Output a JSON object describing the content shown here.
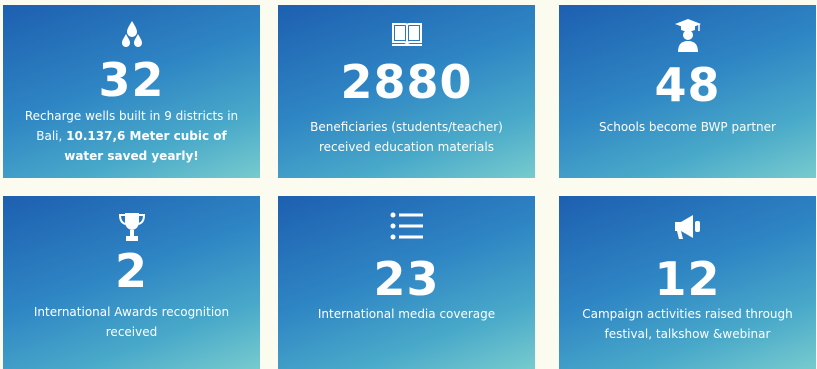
{
  "stats": [
    {
      "icon": "water-drops-icon",
      "number": "32",
      "desc_plain": "Recharge wells built in 9 districts in Bali, ",
      "desc_bold": "10.137,6 Meter cubic of water saved yearly!"
    },
    {
      "icon": "open-book-icon",
      "number": "2880",
      "desc_plain": "Beneficiaries (students/teacher) received education materials",
      "desc_bold": ""
    },
    {
      "icon": "graduate-icon",
      "number": "48",
      "desc_plain": "Schools become BWP partner",
      "desc_bold": ""
    },
    {
      "icon": "trophy-icon",
      "number": "2",
      "desc_plain": "International Awards recognition received",
      "desc_bold": ""
    },
    {
      "icon": "list-icon",
      "number": "23",
      "desc_plain": "International media coverage",
      "desc_bold": ""
    },
    {
      "icon": "megaphone-icon",
      "number": "12",
      "desc_plain": "Campaign activities raised through festival, talkshow &webinar",
      "desc_bold": ""
    }
  ]
}
